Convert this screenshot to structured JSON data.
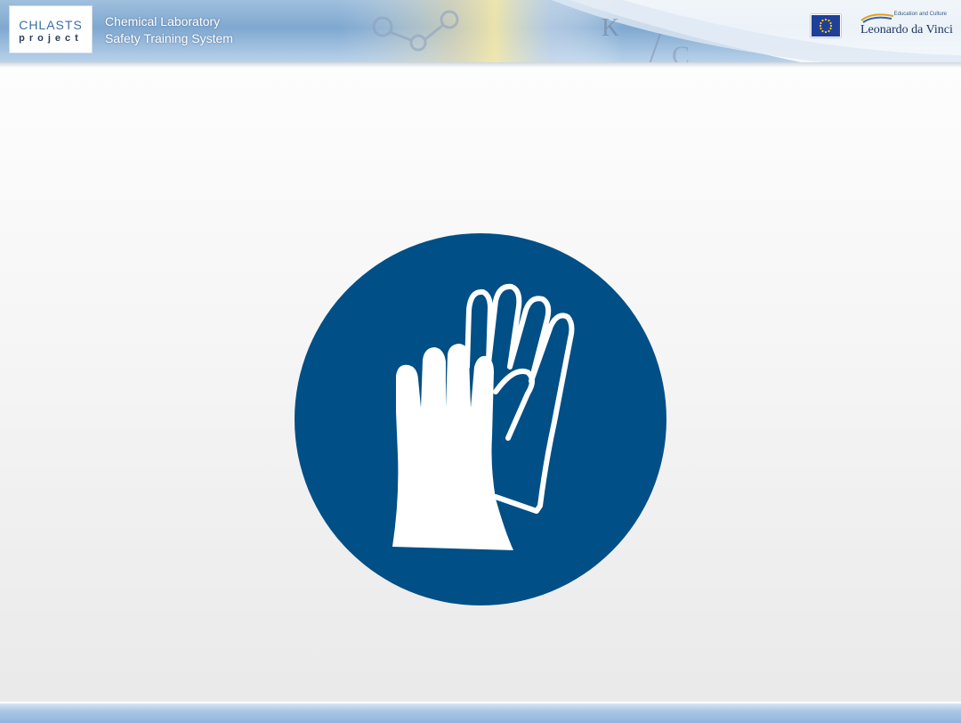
{
  "header": {
    "project_logo": {
      "line1": "CHLASTS",
      "line2": "project"
    },
    "title_line1": "Chemical Laboratory",
    "title_line2": "Safety Training System",
    "partner_logo": {
      "tagline": "Education and Culture",
      "name": "Leonardo da Vinci"
    },
    "icons": [
      "eu-flag-icon",
      "leonardo-da-vinci-logo"
    ]
  },
  "main": {
    "sign_icon": "protective-gloves-icon",
    "colors": {
      "sign_blue": "#004f86",
      "glove_white": "#ffffff"
    }
  }
}
